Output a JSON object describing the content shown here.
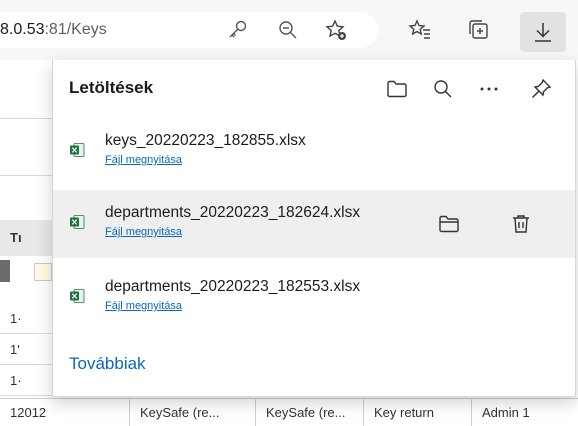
{
  "browser": {
    "address_host": "8.0.53",
    "address_rest": ":81/Keys",
    "icons": [
      "key-icon",
      "zoom-out-icon",
      "add-favorite-icon",
      "favorites-icon",
      "collections-icon",
      "download-icon"
    ]
  },
  "page": {
    "column_header_fragment": "Tı",
    "row_fragments": [
      "1·",
      "1'",
      "1·"
    ],
    "bottom_row": [
      "12012",
      "KeySafe (re...",
      "KeySafe (re...",
      "Key return",
      "Admin 1"
    ]
  },
  "downloads": {
    "title": "Letöltések",
    "header_icons": [
      "open-folder-icon",
      "search-icon",
      "more-icon",
      "pin-icon"
    ],
    "items": [
      {
        "filename": "keys_20220223_182855.xlsx",
        "action": "Fájl megnyitása"
      },
      {
        "filename": "departments_20220223_182624.xlsx",
        "action": "Fájl megnyitása"
      },
      {
        "filename": "departments_20220223_182553.xlsx",
        "action": "Fájl megnyitása"
      }
    ],
    "more_label": "Továbbiak"
  }
}
